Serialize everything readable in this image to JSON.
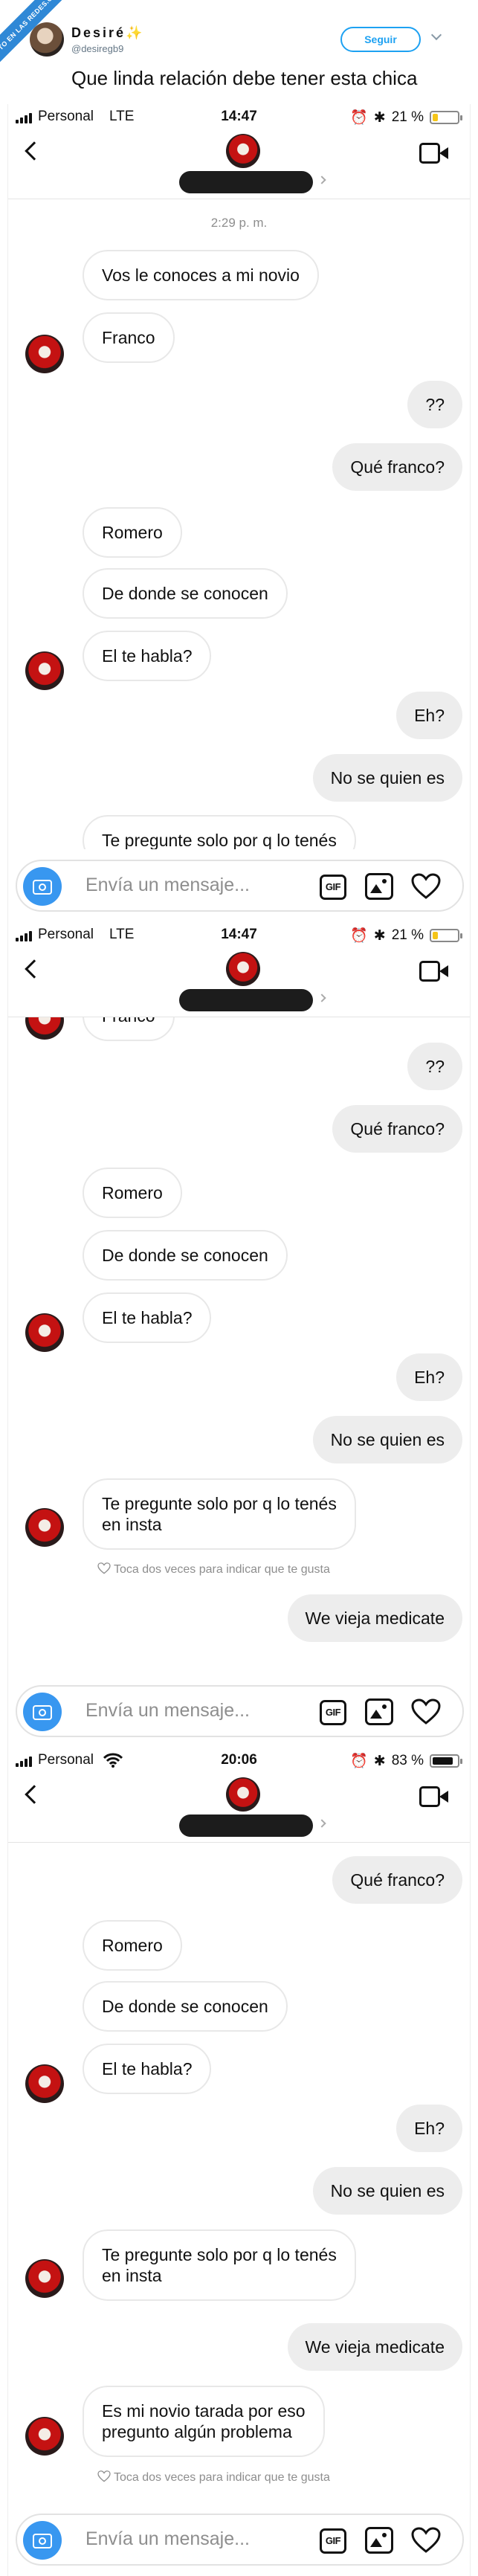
{
  "tweet": {
    "ribbon": "VISTO EN LAS REDES.COM",
    "user_name": "Desiré",
    "spark": "✨",
    "handle": "@desiregb9",
    "follow_label": "Seguir",
    "text": "Que linda relación debe tener esta chica"
  },
  "screens": [
    {
      "status": {
        "carrier": "Personal",
        "network": "LTE",
        "time": "14:47",
        "battery": "21 %",
        "battery_level": 0.21,
        "battery_color": "#f5c518"
      },
      "timestamp": "2:29 p. m.",
      "messages": [
        {
          "side": "in",
          "text": "Vos le conoces a mi novio"
        },
        {
          "side": "in",
          "text": "Franco"
        },
        {
          "side": "out",
          "text": "??"
        },
        {
          "side": "out",
          "text": "Qué franco?"
        },
        {
          "side": "in",
          "text": "Romero"
        },
        {
          "side": "in",
          "text": "De donde se conocen"
        },
        {
          "side": "in",
          "text": "El te habla?"
        },
        {
          "side": "out",
          "text": "Eh?"
        },
        {
          "side": "out",
          "text": "No se quien es"
        },
        {
          "side": "in",
          "text": "Te pregunte solo por q lo tenés"
        }
      ],
      "composer_placeholder": "Envía un mensaje...",
      "gif_label": "GIF"
    },
    {
      "status": {
        "carrier": "Personal",
        "network": "LTE",
        "time": "14:47",
        "battery": "21 %",
        "battery_level": 0.21,
        "battery_color": "#f5c518"
      },
      "messages": [
        {
          "side": "in",
          "text": "Franco"
        },
        {
          "side": "out",
          "text": "??"
        },
        {
          "side": "out",
          "text": "Qué franco?"
        },
        {
          "side": "in",
          "text": "Romero"
        },
        {
          "side": "in",
          "text": "De donde se conocen"
        },
        {
          "side": "in",
          "text": "El te habla?"
        },
        {
          "side": "out",
          "text": "Eh?"
        },
        {
          "side": "out",
          "text": "No se quien es"
        },
        {
          "side": "in",
          "text": "Te pregunte solo por q lo tenés\nen insta"
        },
        {
          "side": "out",
          "text": "We vieja medicate"
        }
      ],
      "like_hint": "Toca dos veces para indicar que te gusta",
      "composer_placeholder": "Envía un mensaje...",
      "gif_label": "GIF"
    },
    {
      "status": {
        "carrier": "Personal",
        "network": "wifi",
        "time": "20:06",
        "battery": "83 %",
        "battery_level": 0.83,
        "battery_color": "#111111"
      },
      "messages": [
        {
          "side": "out",
          "text": "Qué franco?"
        },
        {
          "side": "in",
          "text": "Romero"
        },
        {
          "side": "in",
          "text": "De donde se conocen"
        },
        {
          "side": "in",
          "text": "El te habla?"
        },
        {
          "side": "out",
          "text": "Eh?"
        },
        {
          "side": "out",
          "text": "No se quien es"
        },
        {
          "side": "in",
          "text": "Te pregunte solo por q lo tenés\nen insta"
        },
        {
          "side": "out",
          "text": "We vieja medicate"
        },
        {
          "side": "in",
          "text": "Es mi novio tarada por eso\npregunto algún problema"
        }
      ],
      "like_hint": "Toca dos veces para indicar que te gusta",
      "composer_placeholder": "Envía un mensaje...",
      "gif_label": "GIF"
    }
  ],
  "icons": {
    "back": "chevron-left-icon",
    "video": "video-camera-icon",
    "camera": "camera-icon",
    "gif": "gif-icon",
    "gallery": "gallery-icon",
    "heart": "heart-icon",
    "alarm": "alarm-icon",
    "bluetooth": "bluetooth-icon"
  },
  "colors": {
    "camera_button": "#3897f0",
    "follow": "#1da1f2",
    "outgoing_bubble": "#ededed"
  }
}
